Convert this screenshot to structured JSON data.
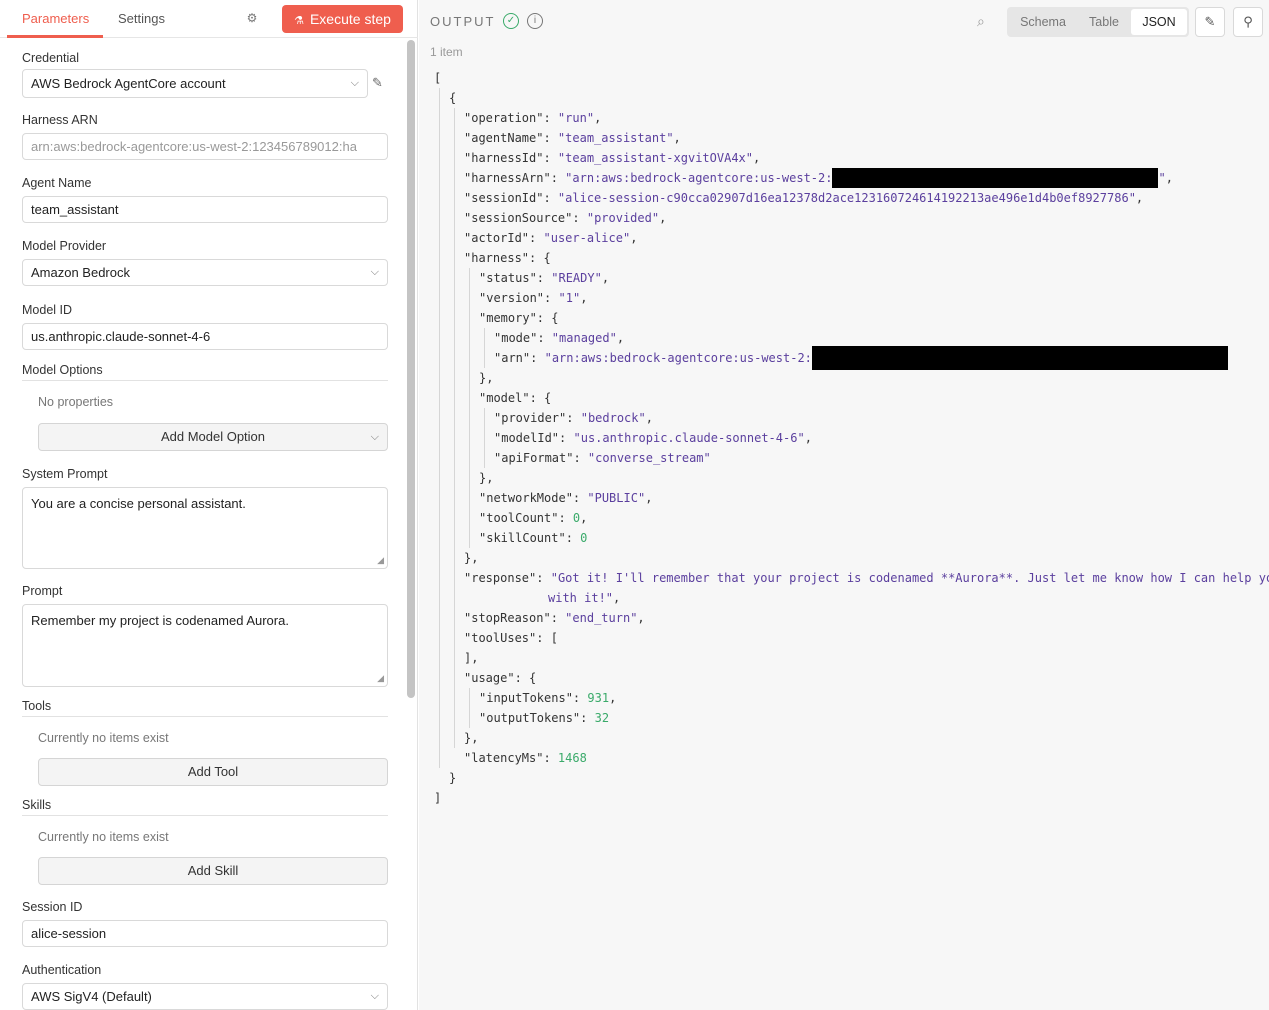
{
  "left_panel": {
    "tabs": {
      "parameters": "Parameters",
      "settings": "Settings"
    },
    "execute_label": "Execute step",
    "credential": {
      "label": "Credential",
      "value": "AWS Bedrock AgentCore account"
    },
    "harness_arn": {
      "label": "Harness ARN",
      "value": "arn:aws:bedrock-agentcore:us-west-2:123456789012:ha"
    },
    "agent_name": {
      "label": "Agent Name",
      "value": "team_assistant"
    },
    "model_provider": {
      "label": "Model Provider",
      "value": "Amazon Bedrock"
    },
    "model_id": {
      "label": "Model ID",
      "value": "us.anthropic.claude-sonnet-4-6"
    },
    "model_options": {
      "label": "Model Options",
      "hint": "No properties",
      "button": "Add Model Option"
    },
    "system_prompt": {
      "label": "System Prompt",
      "value": "You are a concise personal assistant."
    },
    "prompt": {
      "label": "Prompt",
      "value": "Remember my project is codenamed Aurora."
    },
    "tools": {
      "label": "Tools",
      "hint": "Currently no items exist",
      "button": "Add Tool"
    },
    "skills": {
      "label": "Skills",
      "hint": "Currently no items exist",
      "button": "Add Skill"
    },
    "session_id": {
      "label": "Session ID",
      "value": "alice-session"
    },
    "authentication": {
      "label": "Authentication",
      "value": "AWS SigV4 (Default)"
    }
  },
  "output": {
    "title": "OUTPUT",
    "item_count": "1 item",
    "views": {
      "schema": "Schema",
      "table": "Table",
      "json": "JSON"
    },
    "active_view": "JSON",
    "json": {
      "operation": "run",
      "agentName": "team_assistant",
      "harnessId": "team_assistant-xgvitOVA4x",
      "harnessArn_visible": "arn:aws:bedrock-agentcore:us-west-2:",
      "sessionId": "alice-session-c90cca02907d16ea12378d2ace123160724614192213ae496e1d4b0ef8927786",
      "sessionSource": "provided",
      "actorId": "user-alice",
      "harness_status": "READY",
      "harness_version": "1",
      "memory_mode": "managed",
      "memory_arn_visible": "arn:aws:bedrock-agentcore:us-west-2:",
      "model_provider": "bedrock",
      "model_modelId": "us.anthropic.claude-sonnet-4-6",
      "model_apiFormat": "converse_stream",
      "networkMode": "PUBLIC",
      "toolCount": "0",
      "skillCount": "0",
      "response_line1": "Got it! I'll remember that your project is codenamed **Aurora**. Just let me know how I can help you",
      "response_line2": "with it!",
      "stopReason": "end_turn",
      "inputTokens": "931",
      "outputTokens": "32",
      "latencyMs": "1468"
    }
  }
}
